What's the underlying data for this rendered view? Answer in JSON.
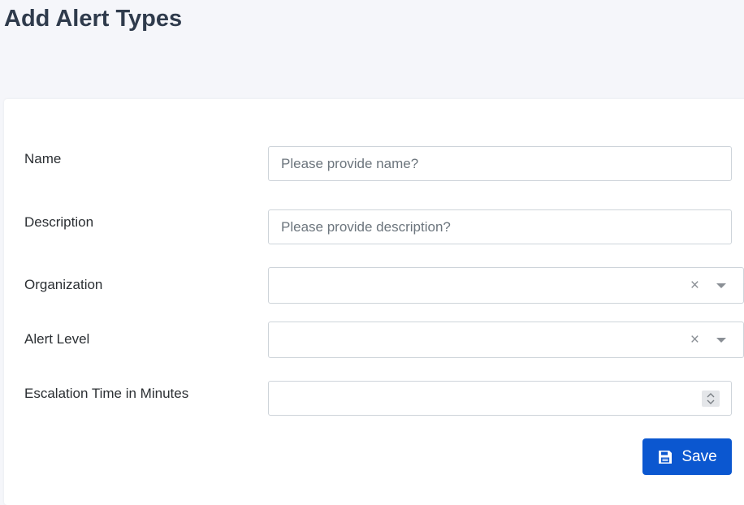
{
  "page": {
    "title": "Add Alert Types"
  },
  "form": {
    "name": {
      "label": "Name",
      "placeholder": "Please provide name?",
      "value": ""
    },
    "description": {
      "label": "Description",
      "placeholder": "Please provide description?",
      "value": ""
    },
    "organization": {
      "label": "Organization",
      "selected": "",
      "clear_glyph": "×"
    },
    "alert_level": {
      "label": "Alert Level",
      "selected": "",
      "clear_glyph": "×"
    },
    "escalation_time": {
      "label": "Escalation Time in Minutes",
      "value": ""
    },
    "save_label": "Save"
  },
  "icons": {
    "save": "floppy-disk-icon",
    "clear": "close-icon",
    "caret": "chevron-down-icon",
    "spinner": "spinner-arrows-icon"
  },
  "colors": {
    "accent": "#0b57d0",
    "background": "#f5f6fa",
    "title": "#2f3b4c"
  }
}
